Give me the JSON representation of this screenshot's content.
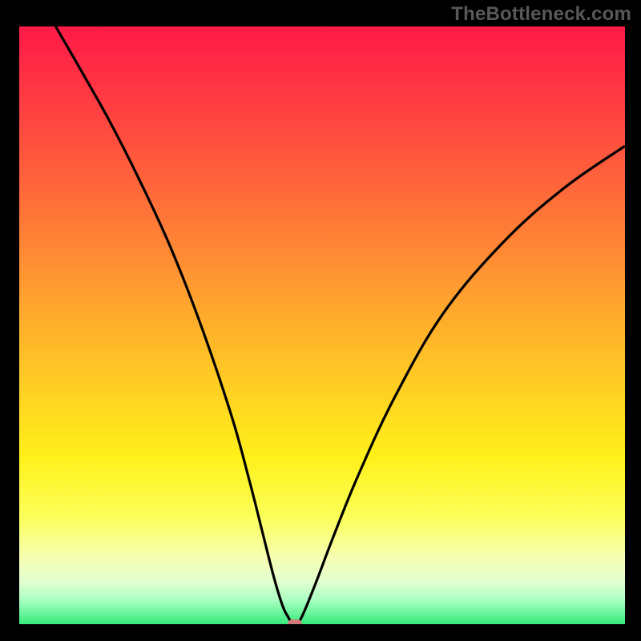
{
  "watermark": {
    "text": "TheBottleneck.com"
  },
  "colors": {
    "background": "#000000",
    "curve_stroke": "#000000",
    "marker_fill": "#cf7b79",
    "gradient_stops": [
      "#ff1a48",
      "#ff3a42",
      "#ff6a3a",
      "#ff9a30",
      "#ffc825",
      "#fff01a",
      "#fbff58",
      "#f6ffb3",
      "#e1ffd1",
      "#a8ffc1",
      "#35eb7a"
    ]
  },
  "chart_data": {
    "type": "line",
    "title": "",
    "xlabel": "",
    "ylabel": "",
    "xlim": [
      0,
      100
    ],
    "ylim": [
      0,
      100
    ],
    "grid": false,
    "series": [
      {
        "name": "bottleneck-curve-left",
        "x": [
          6,
          10,
          15,
          20,
          25,
          30,
          35,
          38,
          40,
          42,
          43.5,
          44.5,
          45
        ],
        "y": [
          100,
          93,
          84,
          74,
          63,
          50,
          35,
          24,
          16,
          8,
          3,
          1,
          0
        ]
      },
      {
        "name": "bottleneck-curve-right",
        "x": [
          46,
          47,
          49,
          52,
          56,
          62,
          70,
          80,
          90,
          100
        ],
        "y": [
          0,
          2,
          7,
          15,
          25,
          38,
          52,
          64,
          73,
          80
        ]
      }
    ],
    "marker": {
      "x": 45.5,
      "y": 0,
      "name": "optimum-marker"
    }
  }
}
